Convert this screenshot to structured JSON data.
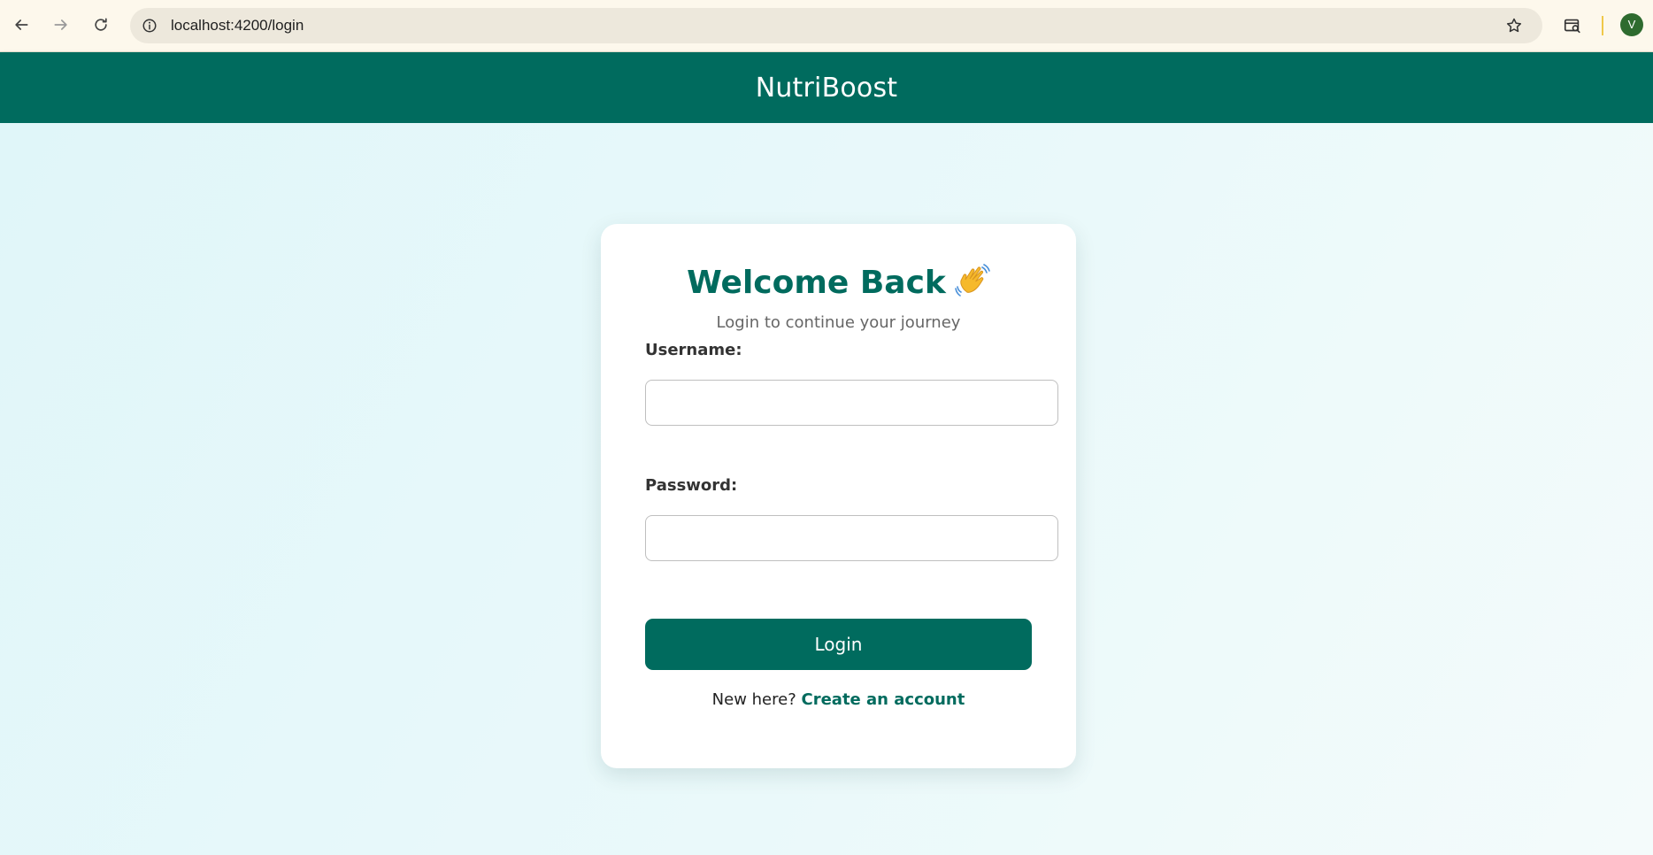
{
  "browser": {
    "url": "localhost:4200/login",
    "profile_initial": "V",
    "icons": {
      "back": "arrow-left-icon",
      "forward": "arrow-right-icon",
      "reload": "reload-icon",
      "site_info": "info-icon",
      "bookmark": "star-icon",
      "search_tab": "tab-search-icon"
    }
  },
  "header": {
    "app_name": "NutriBoost",
    "background": "#006b5e"
  },
  "login_card": {
    "title": "Welcome Back",
    "title_icon": "waving-hand-icon",
    "subtitle": "Login to continue your journey",
    "username_label": "Username:",
    "username_value": "",
    "password_label": "Password:",
    "password_value": "",
    "submit_label": "Login",
    "signup_prompt": "New here?",
    "signup_link": "Create an account"
  },
  "colors": {
    "accent": "#006b5e",
    "page_background": "#e8f7fa",
    "card_background": "#ffffff"
  }
}
